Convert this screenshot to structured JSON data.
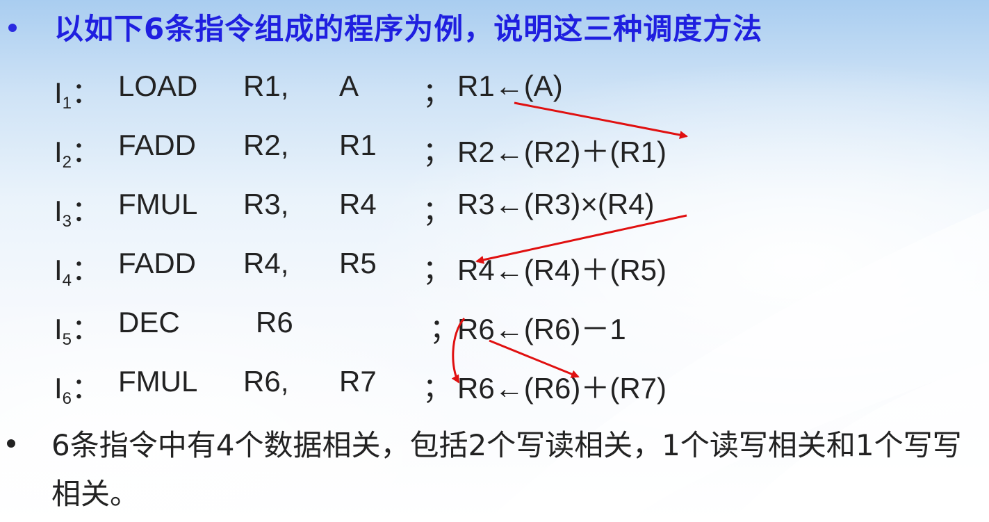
{
  "title": "以如下6条指令组成的程序为例，说明这三种调度方法",
  "instructions": [
    {
      "label": "I",
      "sub": "1",
      "colon": "：",
      "op": "LOAD",
      "arg1": "R1,",
      "arg2": "A",
      "semi": "；",
      "comment": "R1←(A)"
    },
    {
      "label": "I",
      "sub": "2",
      "colon": "：",
      "op": "FADD",
      "arg1": "R2,",
      "arg2": "R1",
      "semi": "；",
      "comment": "R2←(R2)＋(R1)"
    },
    {
      "label": "I",
      "sub": "3",
      "colon": "：",
      "op": "FMUL",
      "arg1": "R3,",
      "arg2": "R4",
      "semi": "；",
      "comment": "R3←(R3)×(R4)"
    },
    {
      "label": "I",
      "sub": "4",
      "colon": "：",
      "op": "FADD",
      "arg1": "R4,",
      "arg2": "R5",
      "semi": "；",
      "comment": "R4←(R4)＋(R5)"
    },
    {
      "label": "I",
      "sub": "5",
      "colon": "：",
      "op": "DEC",
      "arg1": "R6",
      "arg2": "",
      "semi": "；",
      "comment": "R6←(R6)－1"
    },
    {
      "label": "I",
      "sub": "6",
      "colon": "：",
      "op": "FMUL",
      "arg1": "R6,",
      "arg2": "R7",
      "semi": "；",
      "comment": "R6←(R6)＋(R7)"
    }
  ],
  "summary": "6条指令中有4个数据相关，包括2个写读相关，1个读写相关和1个写写相关。",
  "colors": {
    "title": "#1f1fe0",
    "text": "#222222",
    "arrow": "#e01010"
  }
}
